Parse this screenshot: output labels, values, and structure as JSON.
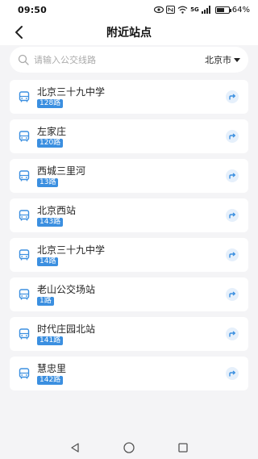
{
  "status_bar": {
    "time": "09:50",
    "battery": "64%",
    "battery_level": 0.64,
    "icons": [
      "eye-icon",
      "nfc-icon",
      "wifi-icon",
      "signal-5g-icon"
    ],
    "network": "5G"
  },
  "header": {
    "title": "附近站点",
    "back_icon": "back-arrow-icon"
  },
  "search": {
    "placeholder": "请输入公交线路",
    "city": "北京市"
  },
  "stations": [
    {
      "name": "北京三十九中学",
      "route": "128路"
    },
    {
      "name": "左家庄",
      "route": "120路"
    },
    {
      "name": "西城三里河",
      "route": "13路"
    },
    {
      "name": "北京西站",
      "route": "143路"
    },
    {
      "name": "北京三十九中学",
      "route": "14路"
    },
    {
      "name": "老山公交场站",
      "route": "1路"
    },
    {
      "name": "时代庄园北站",
      "route": "141路"
    },
    {
      "name": "慧忠里",
      "route": "142路"
    }
  ],
  "colors": {
    "accent": "#3b8fe0",
    "background": "#f4f4f6",
    "card": "#ffffff"
  }
}
